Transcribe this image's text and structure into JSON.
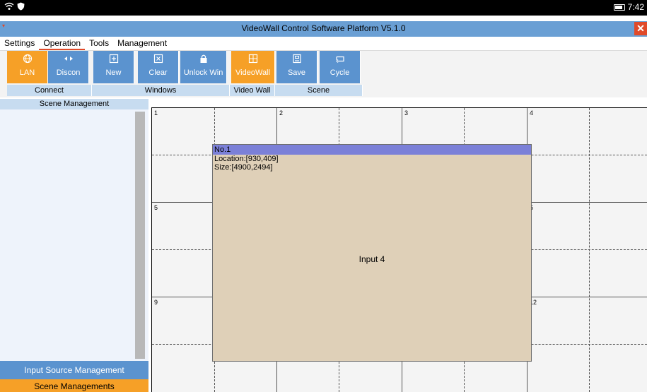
{
  "status_bar": {
    "time": "7:42",
    "icons": [
      "wifi-icon",
      "shield-icon",
      "battery-icon"
    ]
  },
  "window": {
    "title": "VideoWall Control Software Platform V5.1.0",
    "close_label": "✕"
  },
  "menu": {
    "items": [
      "Settings",
      "Operation",
      "Tools",
      "Management"
    ],
    "active": "Operation"
  },
  "ribbon": {
    "buttons": [
      {
        "label": "LAN",
        "icon": "globe-icon",
        "state": "active"
      },
      {
        "label": "Discon",
        "icon": "disconnect-arrows-icon"
      },
      {
        "label": "New",
        "icon": "new-window-icon"
      },
      {
        "label": "Clear",
        "icon": "clear-window-icon"
      },
      {
        "label": "Unlock Win",
        "icon": "lock-icon"
      },
      {
        "label": "VideoWall",
        "icon": "grid-icon",
        "state": "active"
      },
      {
        "label": "Save",
        "icon": "save-icon"
      },
      {
        "label": "Cycle",
        "icon": "cycle-icon"
      }
    ],
    "groups": [
      "Connect",
      "Windows",
      "Video Wall",
      "Scene"
    ]
  },
  "left_panel": {
    "header": "Scene Management",
    "input_source_button": "Input Source Management",
    "scene_button": "Scene Managements"
  },
  "video_wall": {
    "screen_numbers": [
      "1",
      "2",
      "3",
      "4",
      "5",
      "6",
      "9",
      "12"
    ],
    "window": {
      "title": "No.1",
      "location": "Location:[930,409]",
      "size": "Size:[4900,2494]",
      "source": "Input 4"
    }
  },
  "colors": {
    "accent_blue": "#5b93cf",
    "accent_orange": "#f6a027",
    "title_bar": "#6a9fd4",
    "window_fill": "#dfd0b8",
    "window_title": "#7b80d8",
    "close_red": "#e04a2a"
  }
}
